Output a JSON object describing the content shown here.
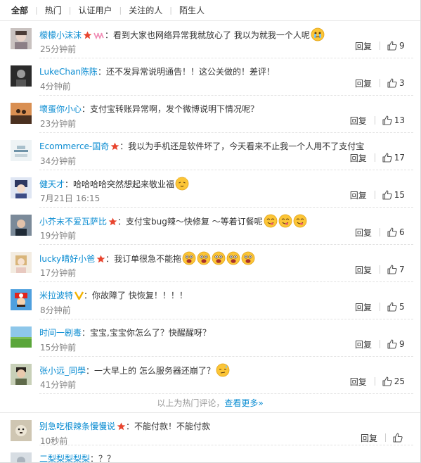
{
  "tabs": [
    "全部",
    "热门",
    "认证用户",
    "关注的人",
    "陌生人"
  ],
  "reply_label": "回复",
  "comments": [
    {
      "user": "檬檬小沫沫",
      "text": "：看到大家也网络异常我就放心了 我以为就我一个人呢",
      "time": "25分钟前",
      "likes": "9",
      "badges": [
        "star",
        "vip"
      ],
      "emoji": [
        "cry"
      ]
    },
    {
      "user": "LukeChan陈陈",
      "text": "：还不发异常说明通告！！这公关做的！差评！",
      "time": "4分钟前",
      "likes": "3",
      "badges": [],
      "emoji": []
    },
    {
      "user": "壞蛋你小心",
      "text": "：支付宝转账异常啊，发个微博说明下情况呢？",
      "time": "23分钟前",
      "likes": "13",
      "badges": [],
      "emoji": []
    },
    {
      "user": "Ecommerce-国奇",
      "text": "：我以为手机还是软件坏了，今天看来不止我一个人用不了支付宝",
      "time": "34分钟前",
      "likes": "17",
      "badges": [
        "star"
      ],
      "emoji": []
    },
    {
      "user": "健天才",
      "text": "：哈哈哈哈突然想起来敬业福",
      "time": "7月21日 16:15",
      "likes": "15",
      "badges": [],
      "emoji": [
        "cat"
      ]
    },
    {
      "user": "小芥末不爱瓦萨比",
      "text": "：支付宝bug辣～快修复 ～等着订餐呢",
      "time": "19分钟前",
      "likes": "6",
      "badges": [
        "star"
      ],
      "emoji": [
        "yum",
        "yum",
        "yum"
      ]
    },
    {
      "user": "lucky晴好小爸",
      "text": "：我订单很急不能拖",
      "time": "17分钟前",
      "likes": "7",
      "badges": [
        "star"
      ],
      "emoji": [
        "shock",
        "shock",
        "shock",
        "shock",
        "shock"
      ]
    },
    {
      "user": "米拉波特",
      "text": "：你故障了 快恢复！！！！",
      "time": "8分钟前",
      "likes": "5",
      "badges": [
        "v"
      ],
      "emoji": []
    },
    {
      "user": "时间一剧毒",
      "text": "：宝宝,宝宝你怎么了？快醒醒呀？",
      "time": "15分钟前",
      "likes": "9",
      "badges": [],
      "emoji": []
    },
    {
      "user": "张小远_同學",
      "text": "：一大早上的  怎么服务器还崩了？",
      "time": "41分钟前",
      "likes": "25",
      "badges": [],
      "emoji": [
        "sweat"
      ]
    }
  ],
  "hot_footer": {
    "text": "以上为热门评论，",
    "link": "查看更多»"
  },
  "new_comments": [
    {
      "user": "别急吃根辣条慢慢说",
      "text": "：不能付款！不能付款",
      "time": "10秒前",
      "likes": "",
      "badges": [
        "star"
      ],
      "emoji": []
    },
    {
      "user": "二梨梨梨梨梨",
      "text": "：？？",
      "time": "",
      "likes": "",
      "badges": [],
      "emoji": []
    }
  ],
  "colors": {
    "link": "#0a8cd2",
    "time": "#808080",
    "star": "#e8452f",
    "vip": "#f08ab4",
    "v": "#f2b200",
    "emoji": "#fcc536"
  },
  "avatars": [
    "girl-photo",
    "bw-portrait",
    "couple-sunset",
    "ecommerce-logo",
    "anime-boy",
    "profile-photo",
    "blonde-girl",
    "mario-cap",
    "green-field",
    "young-man"
  ]
}
